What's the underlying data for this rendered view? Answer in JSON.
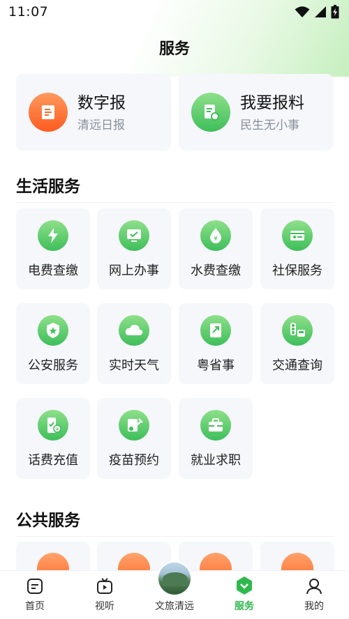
{
  "status_bar": {
    "time": "11:07"
  },
  "header": {
    "title": "服务"
  },
  "features": [
    {
      "title": "数字报",
      "subtitle": "清远日报",
      "icon": "newspaper-icon",
      "color": "#ff6a2c"
    },
    {
      "title": "我要报料",
      "subtitle": "民生无小事",
      "icon": "report-icon",
      "color": "#3ebe5a"
    }
  ],
  "life_services": {
    "title": "生活服务",
    "items": [
      {
        "label": "电费查缴",
        "icon": "electricity-bill-icon"
      },
      {
        "label": "网上办事",
        "icon": "online-affairs-icon"
      },
      {
        "label": "水费查缴",
        "icon": "water-bill-icon"
      },
      {
        "label": "社保服务",
        "icon": "social-security-card-icon"
      },
      {
        "label": "公安服务",
        "icon": "police-shield-icon"
      },
      {
        "label": "实时天气",
        "icon": "weather-cloud-icon"
      },
      {
        "label": "粤省事",
        "icon": "yue-sheng-shi-icon"
      },
      {
        "label": "交通查询",
        "icon": "traffic-light-icon"
      },
      {
        "label": "话费充值",
        "icon": "phone-recharge-icon"
      },
      {
        "label": "疫苗预约",
        "icon": "vaccine-icon"
      },
      {
        "label": "就业求职",
        "icon": "briefcase-icon"
      }
    ]
  },
  "public_services": {
    "title": "公共服务"
  },
  "tabbar": {
    "items": [
      {
        "label": "首页",
        "icon": "home-icon"
      },
      {
        "label": "视听",
        "icon": "tv-icon"
      },
      {
        "label": "文旅清远",
        "icon": "landscape-photo-icon"
      },
      {
        "label": "服务",
        "icon": "service-icon",
        "active": true
      },
      {
        "label": "我的",
        "icon": "profile-icon"
      }
    ]
  },
  "colors": {
    "accent_green": "#2fb94d",
    "accent_orange": "#ff6a2c",
    "tile_bg": "#f5f7fb"
  }
}
